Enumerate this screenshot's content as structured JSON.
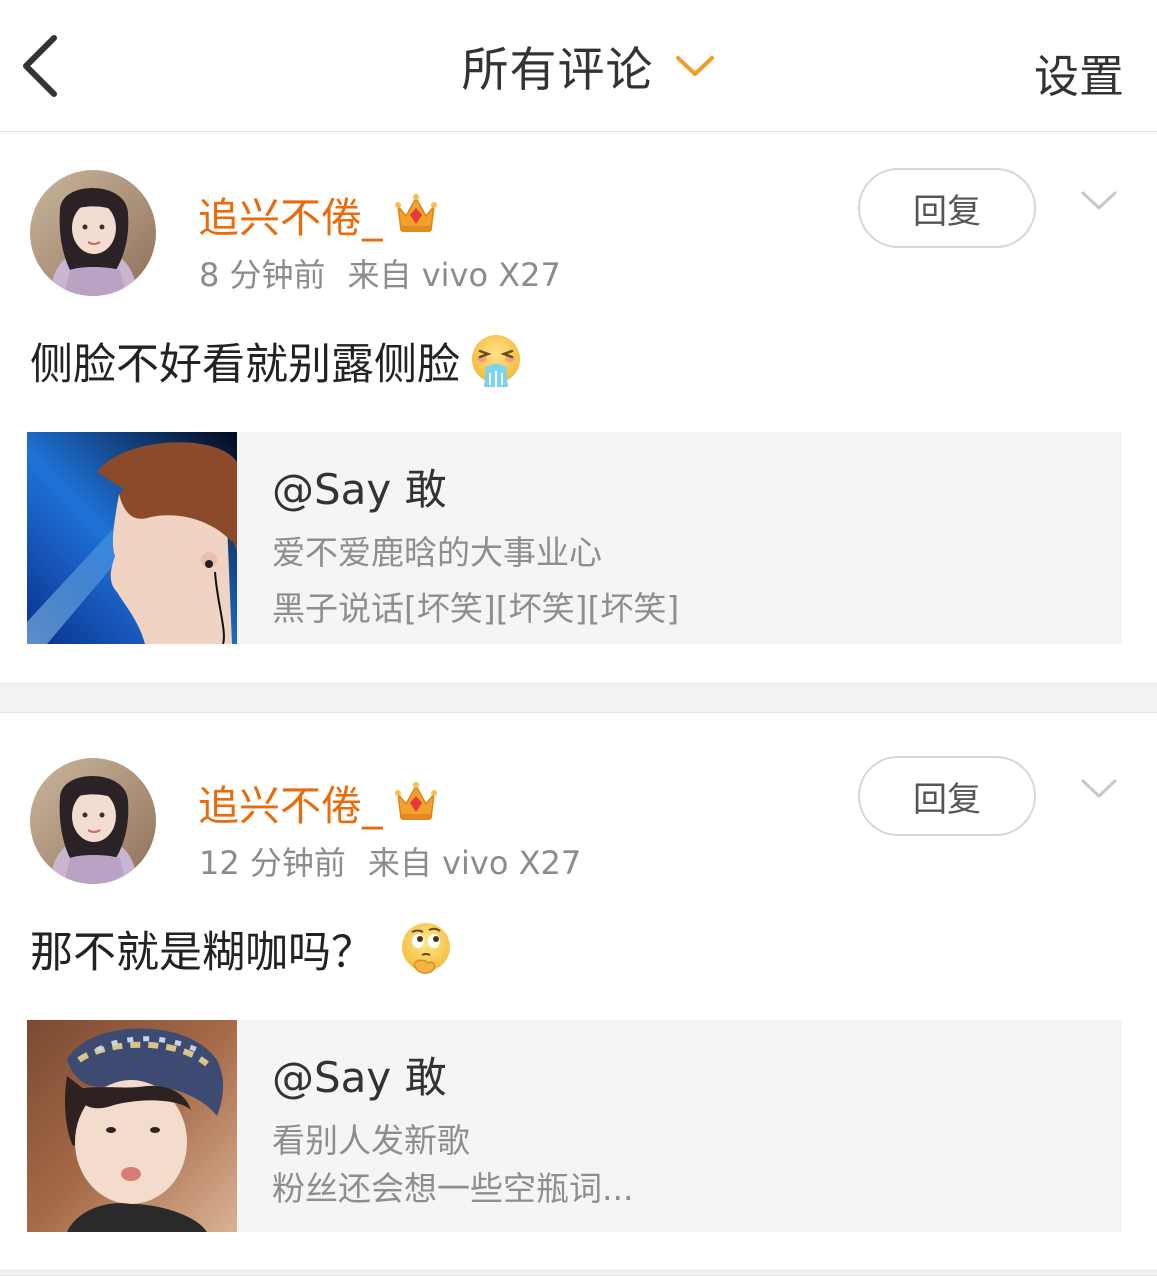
{
  "header": {
    "title": "所有评论",
    "settings_label": "设置"
  },
  "colors": {
    "accent": "#e86b0c",
    "chevron": "#f39a2b",
    "divider": "#f2f2f2"
  },
  "comments": [
    {
      "username": "追兴不倦_",
      "badge_icon": "crown-icon",
      "time": "8 分钟前",
      "source": "来自 vivo X27",
      "reply_label": "回复",
      "text": "侧脸不好看就别露侧脸",
      "emoji_icon": "vomit-emoji-icon",
      "quote": {
        "author": "@Say 敢",
        "lines": [
          "爱不爱鹿晗的大事业心",
          "黑子说话[坏笑][坏笑][坏笑]"
        ]
      }
    },
    {
      "username": "追兴不倦_",
      "badge_icon": "crown-icon",
      "time": "12 分钟前",
      "source": "来自 vivo X27",
      "reply_label": "回复",
      "text": "那不就是糊咖吗？",
      "emoji_icon": "thinking-emoji-icon",
      "quote": {
        "author": "@Say 敢",
        "lines": [
          "看别人发新歌",
          "粉丝还会想一些空瓶词..."
        ]
      }
    }
  ]
}
